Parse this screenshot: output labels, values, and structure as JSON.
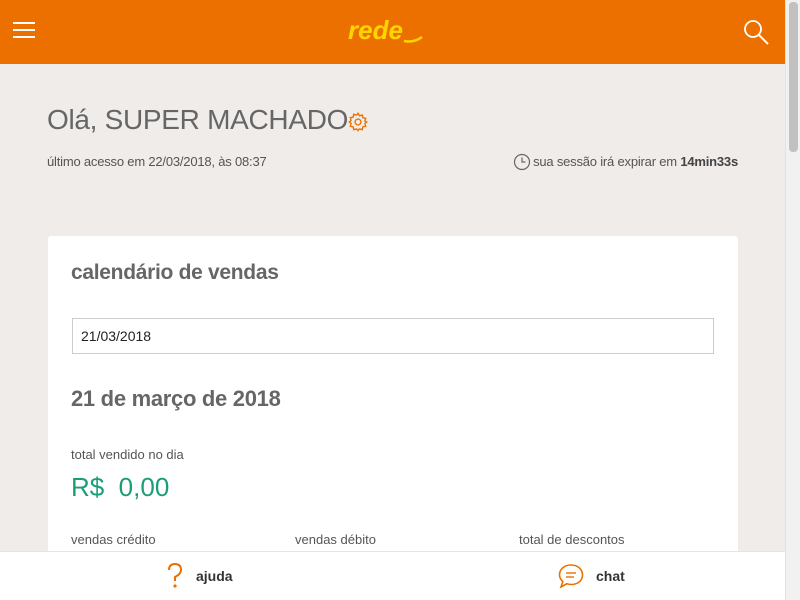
{
  "header": {
    "menu_icon": "hamburger-icon",
    "logo_text": "rede",
    "search_icon": "search-icon",
    "brand_color": "#ec7000",
    "logo_color": "#ffd400"
  },
  "greeting": {
    "text": "Olá, SUPER MACHADO",
    "settings_icon": "gear-icon"
  },
  "last_access": "último acesso em 22/03/2018, às 08:37",
  "session": {
    "prefix": "sua sessão irá expirar em",
    "time": "14min33s",
    "icon": "clock-icon"
  },
  "calendar": {
    "title": "calendário de vendas",
    "date_value": "21/03/2018",
    "date_heading": "21 de março de 2018",
    "total_label": "total vendido no dia",
    "total_value": "R$  0,00",
    "total_color": "#1a9e77",
    "columns": [
      "vendas crédito",
      "vendas débito",
      "total de descontos"
    ]
  },
  "footer": {
    "help_label": "ajuda",
    "help_icon": "question-mark-icon",
    "chat_label": "chat",
    "chat_icon": "chat-bubble-icon"
  }
}
